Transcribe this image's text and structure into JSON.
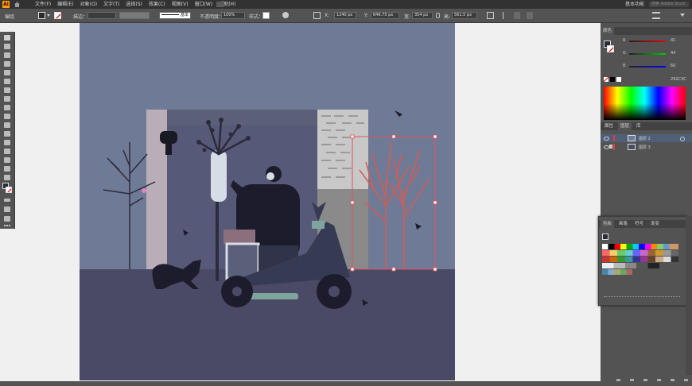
{
  "app": {
    "logo": "Ai"
  },
  "menu": [
    "文件(F)",
    "编辑(E)",
    "对象(O)",
    "文字(T)",
    "选择(S)",
    "效果(C)",
    "视图(V)",
    "窗口(W)",
    "帮助(H)"
  ],
  "workspace": "基本功能",
  "search_placeholder": "搜索 Adobe Stock",
  "control": {
    "group_label": "编组",
    "stroke_label": "描边：",
    "brush_label": "基本",
    "opacity_label": "不透明度：",
    "opacity_value": "100%",
    "style_label": "样式：",
    "x_label": "X:",
    "x_value": "1240 px",
    "y_label": "Y:",
    "y_value": "646.75 px",
    "w_label": "宽:",
    "w_value": "354 px",
    "h_label": "高:",
    "h_value": "561.5 px"
  },
  "color_panel": {
    "tab": "颜色",
    "r_label": "R",
    "g_label": "G",
    "b_label": "B",
    "r_value": "41",
    "g_value": "44",
    "b_value": "60",
    "hex": "292C3C"
  },
  "layers_panel": {
    "tabs": [
      "属性",
      "图层",
      "库"
    ],
    "rows": [
      "图层 2",
      "图层 3"
    ]
  },
  "swatches_panel": {
    "tabs": [
      "色板",
      "画笔",
      "符号",
      "渐变"
    ]
  },
  "colors": {
    "ui_dark": "#323232",
    "ui_mid": "#535353",
    "sky": "#6f7a96",
    "ground": "#4a4a66",
    "selection": "#e2525b",
    "accent": "#ff9a00"
  }
}
